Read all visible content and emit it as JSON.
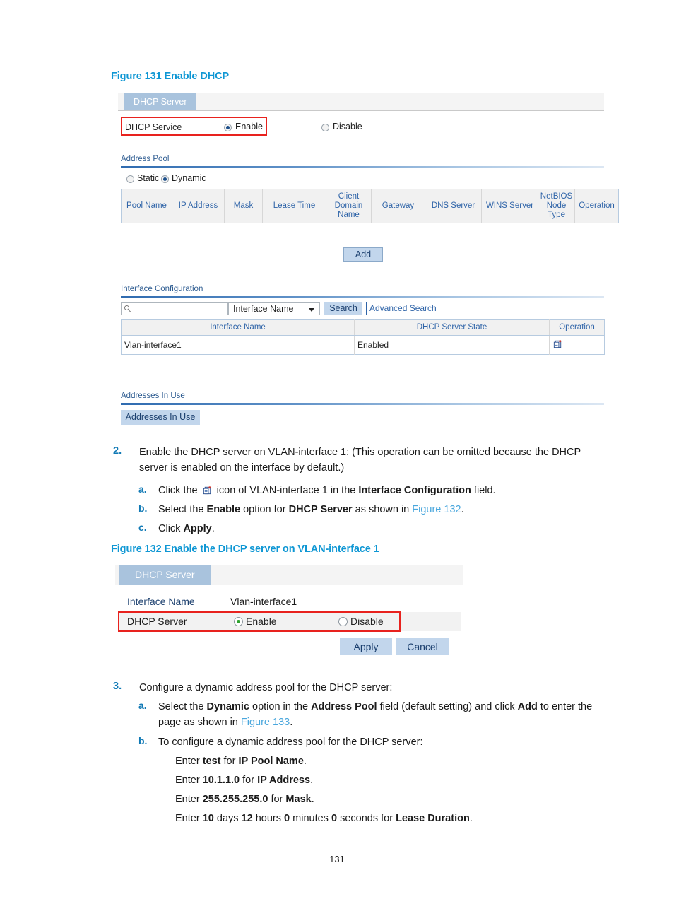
{
  "page": {
    "number": "131"
  },
  "figure131": {
    "title": "Figure 131 Enable DHCP",
    "tab_label": "DHCP Server",
    "dhcp_service_label": "DHCP Service",
    "enable_label": "Enable",
    "disable_label": "Disable",
    "address_pool_section": "Address Pool",
    "static_label": "Static",
    "dynamic_label": "Dynamic",
    "pool_table": {
      "headers": [
        "Pool Name",
        "IP Address",
        "Mask",
        "Lease Time",
        "Client Domain Name",
        "Gateway",
        "DNS Server",
        "WINS Server",
        "NetBIOS Node Type",
        "Operation"
      ],
      "rows": []
    },
    "add_button": "Add",
    "interface_section": "Interface Configuration",
    "search_placeholder": "",
    "search_filter_value": "Interface Name",
    "search_button": "Search",
    "advanced_search": "Advanced Search",
    "iface_table": {
      "headers": [
        "Interface Name",
        "DHCP Server State",
        "Operation"
      ],
      "rows": [
        {
          "name": "Vlan-interface1",
          "state": "Enabled",
          "operation_icon": "edit-page-icon"
        }
      ]
    },
    "addresses_section": "Addresses In Use",
    "addresses_button": "Addresses In Use"
  },
  "step2": {
    "num": "2.",
    "text": "Enable the DHCP server on VLAN-interface 1: (This operation can be omitted because the DHCP server is enabled on the interface by default.)",
    "line1": "Enable the DHCP server on VLAN-interface 1: (This operation can be omitted because the DHCP",
    "line2": "server is enabled on the interface by default.)",
    "a": {
      "num": "a.",
      "part1": "Click the",
      "icon": "edit-page-icon",
      "part2": "icon of VLAN-interface 1 in the",
      "bold": "Interface Configuration",
      "part3": "field."
    },
    "b": {
      "num": "b.",
      "part1": "Select the",
      "bold1": "Enable",
      "part2": "option for",
      "bold2": "DHCP Server",
      "part3": "as shown in",
      "link": "Figure 132",
      "part4": "."
    },
    "c": {
      "num": "c.",
      "part1": "Click",
      "bold": "Apply",
      "part2": "."
    }
  },
  "figure132": {
    "title": "Figure 132 Enable the DHCP server on VLAN-interface 1",
    "tab_label": "DHCP Server",
    "interface_name_label": "Interface Name",
    "interface_name_value": "Vlan-interface1",
    "dhcp_server_label": "DHCP Server",
    "enable_label": "Enable",
    "disable_label": "Disable",
    "apply_button": "Apply",
    "cancel_button": "Cancel"
  },
  "step3": {
    "num": "3.",
    "text": "Configure a dynamic address pool for the DHCP server:",
    "a": {
      "num": "a.",
      "part1": "Select the",
      "bold1": "Dynamic",
      "part2": "option in the",
      "bold2": "Address Pool",
      "part3": "field (default setting) and click",
      "bold3": "Add",
      "part4": "to enter the",
      "line2_part1": "page as shown in",
      "line2_link": "Figure 133",
      "line2_part2": "."
    },
    "b": {
      "num": "b.",
      "text": "To configure a dynamic address pool for the DHCP server:"
    },
    "bullets": [
      {
        "dash": "–",
        "part1": "Enter",
        "bold1": "test",
        "part2": "for",
        "bold2": "IP Pool Name",
        "part3": "."
      },
      {
        "dash": "–",
        "part1": "Enter",
        "bold1": "10.1.1.0",
        "part2": "for",
        "bold2": "IP Address",
        "part3": "."
      },
      {
        "dash": "–",
        "part1": "Enter",
        "bold1": "255.255.255.0",
        "part2": "for",
        "bold2": "Mask",
        "part3": "."
      },
      {
        "dash": "–",
        "part1": "Enter",
        "bold1": "10",
        "part2": "days",
        "bold2": "12",
        "part3": "hours",
        "bold3": "0",
        "part4": "minutes",
        "bold4": "0",
        "part5": "seconds for",
        "bold5": "Lease Duration",
        "part6": "."
      }
    ]
  },
  "colors": {
    "figure_title": "#0f97d4",
    "step_number": "#1079b5",
    "link": "#4aa7dd",
    "tab_bg": "#a9c3dd",
    "button_bg": "#c2d6ec",
    "highlight_border": "#e8221e",
    "section_text": "#2e5c91"
  }
}
